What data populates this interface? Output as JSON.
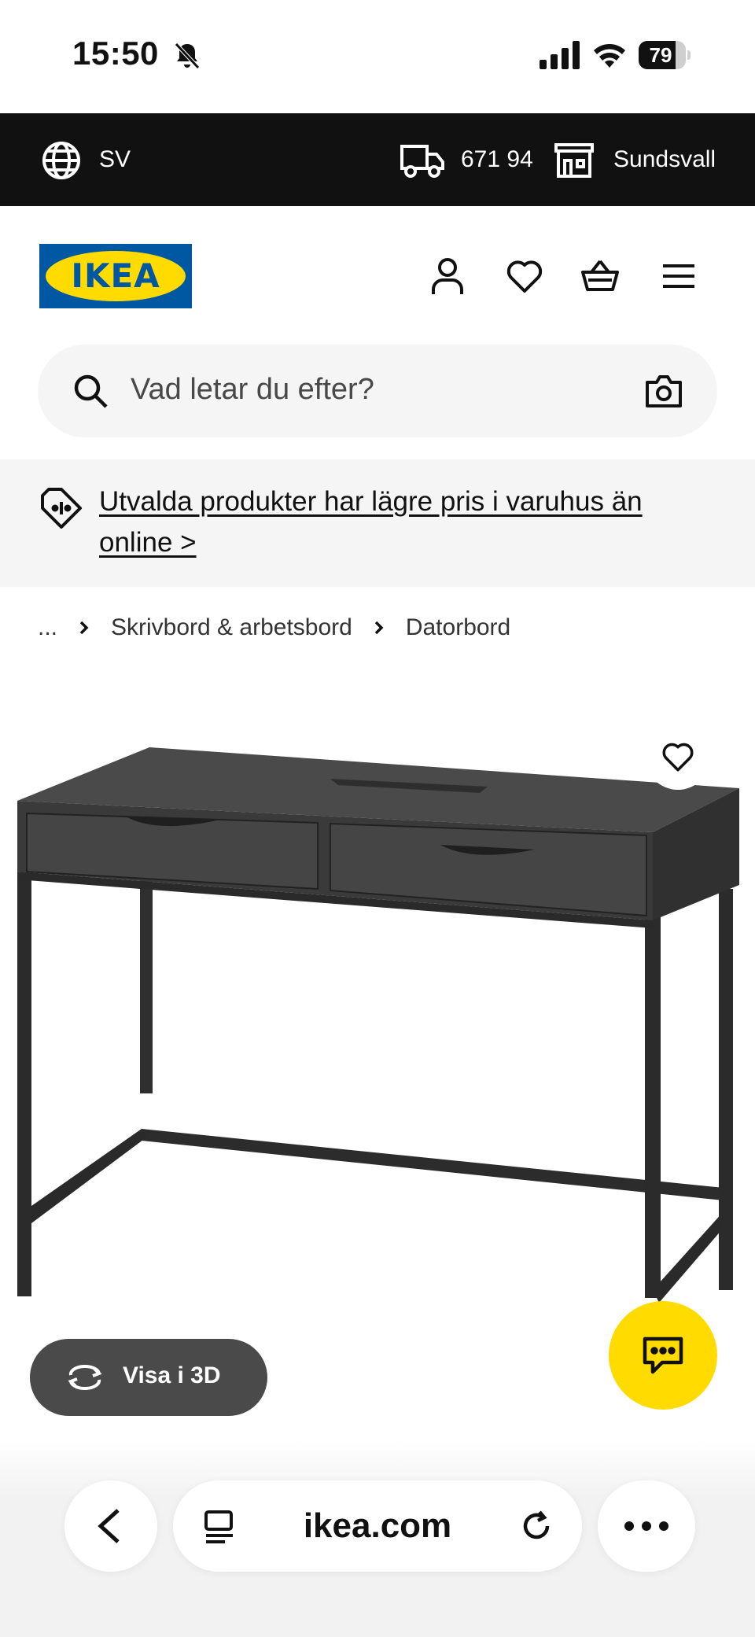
{
  "status_bar": {
    "time": "15:50",
    "battery_level": "79",
    "battery_fraction": 0.79
  },
  "top_bar": {
    "language": "SV",
    "postcode": "671 94",
    "store": "Sundsvall"
  },
  "header": {
    "logo_text": "IKEA"
  },
  "search": {
    "placeholder": "Vad letar du efter?"
  },
  "promo": {
    "text": "Utvalda produkter har lägre pris i varuhus än online >"
  },
  "breadcrumb": {
    "ellipsis": "...",
    "items": [
      "Skrivbord & arbetsbord",
      "Datorbord"
    ]
  },
  "product": {
    "view_3d_label": "Visa i 3D"
  },
  "browser": {
    "url": "ikea.com"
  },
  "colors": {
    "ikea_blue": "#0058a3",
    "ikea_yellow": "#ffdb00",
    "top_bar_bg": "#111111",
    "desk_color": "#3a3a3a"
  },
  "icons": [
    "bell-off-icon",
    "signal-icon",
    "wifi-icon",
    "globe-icon",
    "truck-icon",
    "store-icon",
    "user-icon",
    "heart-icon",
    "basket-icon",
    "menu-icon",
    "search-icon",
    "camera-icon",
    "price-tag-icon",
    "chevron-right-icon",
    "rotate-3d-icon",
    "chat-icon",
    "back-icon",
    "reader-icon",
    "reload-icon",
    "more-icon"
  ]
}
